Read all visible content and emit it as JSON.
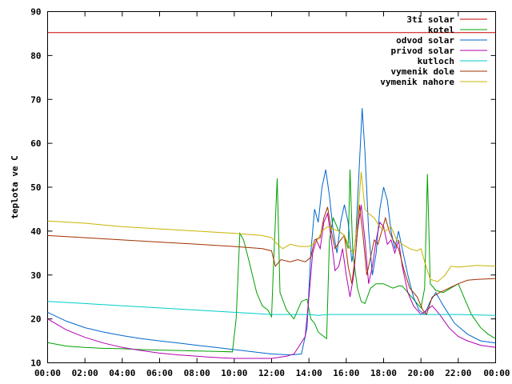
{
  "chart_data": {
    "type": "line",
    "title": "",
    "xlabel": "",
    "ylabel": "teplota ve C",
    "ylim": [
      10,
      90
    ],
    "xlim": [
      0,
      24
    ],
    "grid": false,
    "legend_position": "top-right",
    "yticks": [
      "10",
      "20",
      "30",
      "40",
      "50",
      "60",
      "70",
      "80",
      "90"
    ],
    "xticks": [
      "00:00",
      "02:00",
      "04:00",
      "06:00",
      "08:00",
      "10:00",
      "12:00",
      "14:00",
      "16:00",
      "18:00",
      "20:00",
      "22:00",
      "00:00"
    ],
    "series": [
      {
        "name": "3ti solar",
        "color": "#cc0000",
        "points": [
          [
            0,
            85.2
          ],
          [
            24,
            85.2
          ]
        ]
      },
      {
        "name": "kotel",
        "color": "#00a000",
        "points": [
          [
            0,
            14.6
          ],
          [
            1,
            13.8
          ],
          [
            2,
            13.5
          ],
          [
            3,
            13.3
          ],
          [
            4,
            13.2
          ],
          [
            5,
            13.0
          ],
          [
            6,
            12.9
          ],
          [
            7,
            12.8
          ],
          [
            8,
            12.7
          ],
          [
            9,
            12.6
          ],
          [
            9.9,
            12.5
          ],
          [
            10.1,
            20.0
          ],
          [
            10.3,
            39.5
          ],
          [
            10.5,
            38.0
          ],
          [
            10.8,
            33.0
          ],
          [
            11.2,
            26.0
          ],
          [
            11.5,
            23.0
          ],
          [
            11.8,
            22.0
          ],
          [
            12.0,
            20.5
          ],
          [
            12.1,
            32.0
          ],
          [
            12.3,
            52.0
          ],
          [
            12.45,
            26.0
          ],
          [
            12.8,
            22.0
          ],
          [
            13.2,
            20.0
          ],
          [
            13.6,
            24.0
          ],
          [
            13.9,
            24.5
          ],
          [
            14.1,
            20.0
          ],
          [
            14.3,
            19.0
          ],
          [
            14.5,
            17.0
          ],
          [
            14.8,
            16.0
          ],
          [
            14.95,
            15.5
          ],
          [
            15.1,
            38.0
          ],
          [
            15.3,
            43.0
          ],
          [
            15.6,
            40.0
          ],
          [
            15.9,
            39.0
          ],
          [
            16.1,
            36.0
          ],
          [
            16.2,
            54.0
          ],
          [
            16.35,
            35.0
          ],
          [
            16.6,
            27.0
          ],
          [
            16.8,
            24.0
          ],
          [
            17.0,
            23.5
          ],
          [
            17.3,
            27.0
          ],
          [
            17.6,
            28.0
          ],
          [
            18.0,
            28.0
          ],
          [
            18.5,
            27.0
          ],
          [
            18.8,
            27.5
          ],
          [
            19.0,
            27.5
          ],
          [
            19.3,
            26.0
          ],
          [
            19.7,
            24.0
          ],
          [
            20.0,
            22.5
          ],
          [
            20.2,
            27.0
          ],
          [
            20.35,
            53.0
          ],
          [
            20.5,
            28.0
          ],
          [
            20.8,
            26.5
          ],
          [
            21.2,
            26.0
          ],
          [
            21.6,
            27.0
          ],
          [
            22.0,
            28.0
          ],
          [
            22.3,
            25.0
          ],
          [
            22.7,
            21.0
          ],
          [
            23.2,
            18.0
          ],
          [
            23.6,
            16.5
          ],
          [
            24.0,
            15.5
          ]
        ]
      },
      {
        "name": "odvod solar",
        "color": "#0066cc",
        "points": [
          [
            0,
            21.5
          ],
          [
            1,
            19.5
          ],
          [
            2,
            18.0
          ],
          [
            3,
            17.0
          ],
          [
            4,
            16.2
          ],
          [
            5,
            15.5
          ],
          [
            6,
            15.0
          ],
          [
            7,
            14.5
          ],
          [
            8,
            14.0
          ],
          [
            9,
            13.5
          ],
          [
            10,
            13.0
          ],
          [
            11,
            12.5
          ],
          [
            12,
            12.0
          ],
          [
            13,
            11.8
          ],
          [
            13.6,
            12.0
          ],
          [
            13.9,
            18.0
          ],
          [
            14.1,
            35.0
          ],
          [
            14.3,
            45.0
          ],
          [
            14.5,
            42.0
          ],
          [
            14.7,
            50.0
          ],
          [
            14.9,
            54.0
          ],
          [
            15.1,
            48.0
          ],
          [
            15.3,
            40.0
          ],
          [
            15.5,
            35.0
          ],
          [
            15.7,
            42.0
          ],
          [
            15.9,
            46.0
          ],
          [
            16.1,
            42.0
          ],
          [
            16.3,
            33.0
          ],
          [
            16.5,
            38.0
          ],
          [
            16.7,
            55.0
          ],
          [
            16.85,
            68.0
          ],
          [
            17.0,
            58.0
          ],
          [
            17.2,
            40.0
          ],
          [
            17.4,
            30.0
          ],
          [
            17.6,
            35.0
          ],
          [
            17.8,
            45.0
          ],
          [
            18.0,
            50.0
          ],
          [
            18.2,
            47.0
          ],
          [
            18.4,
            40.0
          ],
          [
            18.6,
            36.0
          ],
          [
            18.8,
            40.0
          ],
          [
            19.0,
            36.0
          ],
          [
            19.3,
            30.0
          ],
          [
            19.6,
            25.0
          ],
          [
            19.9,
            22.0
          ],
          [
            20.2,
            21.0
          ],
          [
            20.5,
            24.0
          ],
          [
            20.8,
            26.0
          ],
          [
            21.2,
            23.0
          ],
          [
            21.8,
            19.0
          ],
          [
            22.5,
            16.5
          ],
          [
            23.2,
            15.0
          ],
          [
            24.0,
            14.5
          ]
        ]
      },
      {
        "name": "privod solar",
        "color": "#b000b0",
        "points": [
          [
            0,
            20.0
          ],
          [
            1,
            17.5
          ],
          [
            2,
            15.8
          ],
          [
            3,
            14.5
          ],
          [
            4,
            13.5
          ],
          [
            5,
            12.8
          ],
          [
            6,
            12.2
          ],
          [
            7,
            11.8
          ],
          [
            8,
            11.5
          ],
          [
            9,
            11.2
          ],
          [
            10,
            11.0
          ],
          [
            11,
            11.0
          ],
          [
            12,
            11.0
          ],
          [
            12.8,
            11.5
          ],
          [
            13.2,
            12.0
          ],
          [
            13.5,
            14.0
          ],
          [
            13.8,
            16.0
          ],
          [
            14.0,
            25.0
          ],
          [
            14.2,
            35.0
          ],
          [
            14.4,
            38.0
          ],
          [
            14.6,
            36.0
          ],
          [
            14.8,
            42.0
          ],
          [
            15.0,
            44.0
          ],
          [
            15.2,
            38.0
          ],
          [
            15.4,
            31.0
          ],
          [
            15.6,
            32.0
          ],
          [
            15.8,
            36.0
          ],
          [
            16.0,
            30.0
          ],
          [
            16.2,
            25.0
          ],
          [
            16.4,
            30.0
          ],
          [
            16.6,
            40.0
          ],
          [
            16.8,
            46.0
          ],
          [
            17.0,
            38.0
          ],
          [
            17.2,
            28.0
          ],
          [
            17.4,
            32.0
          ],
          [
            17.6,
            38.0
          ],
          [
            17.8,
            42.0
          ],
          [
            18.0,
            41.0
          ],
          [
            18.2,
            37.0
          ],
          [
            18.4,
            38.0
          ],
          [
            18.6,
            35.0
          ],
          [
            18.8,
            38.0
          ],
          [
            19.0,
            32.0
          ],
          [
            19.3,
            26.0
          ],
          [
            19.6,
            23.0
          ],
          [
            20.0,
            21.0
          ],
          [
            20.3,
            22.0
          ],
          [
            20.6,
            23.0
          ],
          [
            21.0,
            21.0
          ],
          [
            21.5,
            18.0
          ],
          [
            22.0,
            16.0
          ],
          [
            22.5,
            15.0
          ],
          [
            23.2,
            14.0
          ],
          [
            24.0,
            13.5
          ]
        ]
      },
      {
        "name": "kutloch",
        "color": "#00cccc",
        "points": [
          [
            0,
            24.0
          ],
          [
            2,
            23.5
          ],
          [
            4,
            23.0
          ],
          [
            6,
            22.5
          ],
          [
            8,
            22.0
          ],
          [
            10,
            21.5
          ],
          [
            12,
            21.0
          ],
          [
            14,
            21.0
          ],
          [
            14.5,
            20.8
          ],
          [
            15,
            21.0
          ],
          [
            16,
            21.0
          ],
          [
            18,
            21.0
          ],
          [
            20,
            21.0
          ],
          [
            22,
            21.0
          ],
          [
            24,
            20.8
          ]
        ]
      },
      {
        "name": "vymenik dole",
        "color": "#a03000",
        "points": [
          [
            0,
            39.0
          ],
          [
            2,
            38.5
          ],
          [
            4,
            38.0
          ],
          [
            6,
            37.5
          ],
          [
            8,
            37.0
          ],
          [
            10,
            36.5
          ],
          [
            11.5,
            36.0
          ],
          [
            12.0,
            35.5
          ],
          [
            12.2,
            32.0
          ],
          [
            12.5,
            33.5
          ],
          [
            13.0,
            33.0
          ],
          [
            13.4,
            33.5
          ],
          [
            13.8,
            33.0
          ],
          [
            14.1,
            34.0
          ],
          [
            14.3,
            38.0
          ],
          [
            14.6,
            38.5
          ],
          [
            14.8,
            43.0
          ],
          [
            15.0,
            45.5
          ],
          [
            15.2,
            40.0
          ],
          [
            15.4,
            36.0
          ],
          [
            15.7,
            38.0
          ],
          [
            15.9,
            39.0
          ],
          [
            16.1,
            32.0
          ],
          [
            16.3,
            28.0
          ],
          [
            16.5,
            35.0
          ],
          [
            16.7,
            46.0
          ],
          [
            16.9,
            39.0
          ],
          [
            17.1,
            30.0
          ],
          [
            17.3,
            34.0
          ],
          [
            17.5,
            38.0
          ],
          [
            17.7,
            37.0
          ],
          [
            17.9,
            40.0
          ],
          [
            18.1,
            43.0
          ],
          [
            18.3,
            40.0
          ],
          [
            18.5,
            38.0
          ],
          [
            18.8,
            36.0
          ],
          [
            19.1,
            31.0
          ],
          [
            19.4,
            27.0
          ],
          [
            19.8,
            25.0
          ],
          [
            20.1,
            22.0
          ],
          [
            20.3,
            21.0
          ],
          [
            20.6,
            25.0
          ],
          [
            21.0,
            26.0
          ],
          [
            21.5,
            27.0
          ],
          [
            22.0,
            28.0
          ],
          [
            22.5,
            28.8
          ],
          [
            23.0,
            29.0
          ],
          [
            24.0,
            29.2
          ]
        ]
      },
      {
        "name": "vymenik nahore",
        "color": "#c8b400",
        "points": [
          [
            0,
            42.3
          ],
          [
            2,
            41.8
          ],
          [
            4,
            41.0
          ],
          [
            6,
            40.5
          ],
          [
            8,
            40.0
          ],
          [
            10,
            39.5
          ],
          [
            11.5,
            39.0
          ],
          [
            12.0,
            38.5
          ],
          [
            12.3,
            37.0
          ],
          [
            12.6,
            36.0
          ],
          [
            13.0,
            37.0
          ],
          [
            13.5,
            36.5
          ],
          [
            14.0,
            36.5
          ],
          [
            14.4,
            37.5
          ],
          [
            14.7,
            40.0
          ],
          [
            15.0,
            41.0
          ],
          [
            15.3,
            40.5
          ],
          [
            15.6,
            40.0
          ],
          [
            15.9,
            39.0
          ],
          [
            16.2,
            36.0
          ],
          [
            16.4,
            35.0
          ],
          [
            16.6,
            42.0
          ],
          [
            16.8,
            53.5
          ],
          [
            17.0,
            45.0
          ],
          [
            17.2,
            44.0
          ],
          [
            17.5,
            43.0
          ],
          [
            17.8,
            41.0
          ],
          [
            18.1,
            40.0
          ],
          [
            18.4,
            41.0
          ],
          [
            18.7,
            38.0
          ],
          [
            19.0,
            37.0
          ],
          [
            19.4,
            36.0
          ],
          [
            19.8,
            35.5
          ],
          [
            20.0,
            36.0
          ],
          [
            20.2,
            33.0
          ],
          [
            20.5,
            29.0
          ],
          [
            20.9,
            28.5
          ],
          [
            21.3,
            30.0
          ],
          [
            21.6,
            32.0
          ],
          [
            22.0,
            31.8
          ],
          [
            23.0,
            32.2
          ],
          [
            24.0,
            32.0
          ]
        ]
      }
    ]
  }
}
